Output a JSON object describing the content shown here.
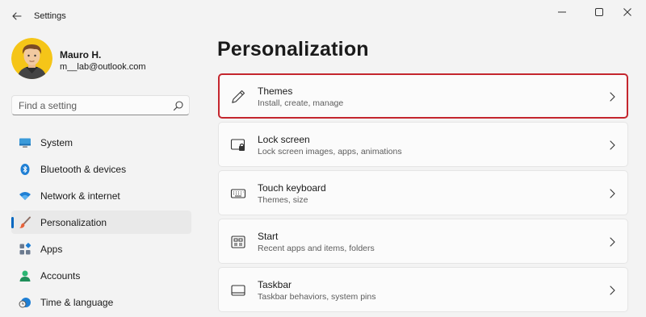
{
  "window": {
    "title": "Settings",
    "back_icon": "back-arrow-icon",
    "controls": [
      "minimize-icon",
      "maximize-icon",
      "close-icon"
    ]
  },
  "profile": {
    "name": "Mauro H.",
    "email": "m__lab@outlook.com",
    "avatar_icon": "avatar-cartoon"
  },
  "search": {
    "placeholder": "Find a setting",
    "value": "",
    "icon": "search-icon"
  },
  "sidebar": {
    "items": [
      {
        "label": "System",
        "icon": "system-monitor-icon",
        "active": false
      },
      {
        "label": "Bluetooth & devices",
        "icon": "bluetooth-icon",
        "active": false
      },
      {
        "label": "Network & internet",
        "icon": "wifi-icon",
        "active": false
      },
      {
        "label": "Personalization",
        "icon": "paintbrush-icon",
        "active": true
      },
      {
        "label": "Apps",
        "icon": "apps-icon",
        "active": false
      },
      {
        "label": "Accounts",
        "icon": "accounts-icon",
        "active": false
      },
      {
        "label": "Time & language",
        "icon": "clock-globe-icon",
        "active": false
      }
    ]
  },
  "main": {
    "title": "Personalization",
    "cards": [
      {
        "title": "Themes",
        "subtitle": "Install, create, manage",
        "icon": "pen-icon",
        "highlighted": true
      },
      {
        "title": "Lock screen",
        "subtitle": "Lock screen images, apps, animations",
        "icon": "lock-screen-icon",
        "highlighted": false
      },
      {
        "title": "Touch keyboard",
        "subtitle": "Themes, size",
        "icon": "keyboard-icon",
        "highlighted": false
      },
      {
        "title": "Start",
        "subtitle": "Recent apps and items, folders",
        "icon": "start-icon",
        "highlighted": false
      },
      {
        "title": "Taskbar",
        "subtitle": "Taskbar behaviors, system pins",
        "icon": "taskbar-icon",
        "highlighted": false
      }
    ]
  },
  "colors": {
    "accent": "#0067c0",
    "highlight_border": "#c4262e",
    "background": "#f3f3f3",
    "card": "#fbfbfb"
  }
}
